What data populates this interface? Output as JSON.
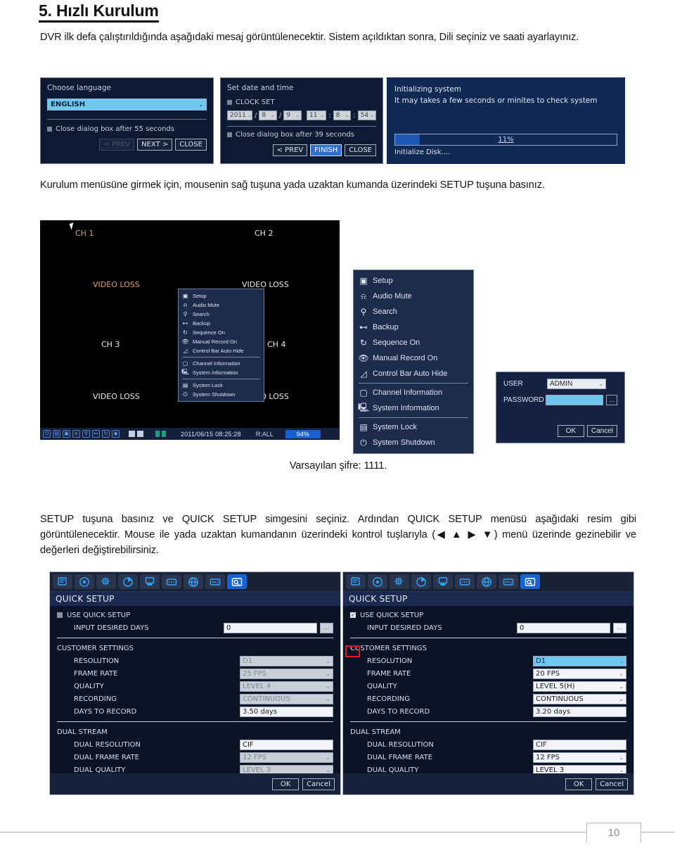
{
  "heading": "5. Hızlı Kurulum",
  "paragraphs": {
    "intro": "DVR ilk defa çalıştırıldığında aşağıdaki mesaj görüntülenecektir. Sistem açıldıktan sonra, Dili seçiniz ve saati ayarlayınız.",
    "setup": "Kurulum menüsüne girmek için, mousenin sağ tuşuna yada uzaktan kumanda üzerindeki SETUP tuşuna basınız.",
    "password": "Varsayılan şifre: 1111.",
    "quick": "SETUP tuşuna basınız ve QUICK SETUP simgesini seçiniz. Ardından QUICK SETUP menüsü aşağıdaki resim gibi görüntülenecektir. Mouse ile yada uzaktan kumandanın üzerindeki kontrol tuşlarıyla (◀ ▲ ▶ ▼) menü üzerinde gezinebilir ve değerleri değiştirebilirsiniz."
  },
  "dialog_language": {
    "title": "Choose language",
    "value": "ENGLISH",
    "arrow": "⌄",
    "close_text": "Close dialog box after 55 seconds",
    "btn_prev": "< PREV",
    "btn_next": "NEXT >",
    "btn_close": "CLOSE"
  },
  "dialog_datetime": {
    "title": "Set date and time",
    "clock_set": "CLOCK SET",
    "year": "2011",
    "month": "8",
    "day": "9",
    "hour": "11",
    "minute": "8",
    "second": "54",
    "sep_date": "/",
    "sep_time": ":",
    "spin": "⌄",
    "close_text": "Close dialog box after 39 seconds",
    "btn_prev": "< PREV",
    "btn_finish": "FINISH",
    "btn_close": "CLOSE"
  },
  "dialog_init": {
    "line1": "Initializing system",
    "line2": "It may takes a few seconds or minites to check system",
    "progress_label": "11%",
    "progress_value": 11,
    "footer": "Initialize Disk...."
  },
  "dvr_live": {
    "channels": [
      {
        "name": "CH 1",
        "status": "VIDEO LOSS"
      },
      {
        "name": "CH 2",
        "status": "VIDEO LOSS"
      },
      {
        "name": "CH 3",
        "status": "VIDEO LOSS"
      },
      {
        "name": "CH 4",
        "status": "VIDEO LOSS"
      }
    ],
    "status_bar": {
      "datetime": "2011/06/15 08:25:28",
      "record_mode": "R:ALL",
      "disk_percent": "94%"
    }
  },
  "context_menu": {
    "items": [
      {
        "label": "Setup",
        "icon": "setup-icon",
        "glyph": "▣"
      },
      {
        "label": "Audio Mute",
        "icon": "microphone-icon",
        "glyph": "⍾"
      },
      {
        "label": "Search",
        "icon": "search-icon",
        "glyph": "⚲"
      },
      {
        "label": "Backup",
        "icon": "backup-icon",
        "glyph": "⊷"
      },
      {
        "label": "Sequence On",
        "icon": "sequence-icon",
        "glyph": "↻"
      },
      {
        "label": "Manual Record On",
        "icon": "record-icon",
        "glyph": "👁"
      },
      {
        "label": "Control Bar Auto Hide",
        "icon": "autohide-icon",
        "glyph": "◿"
      },
      {
        "label": "Channel Information",
        "icon": "channel-info-icon",
        "glyph": "▢"
      },
      {
        "label": "System Information",
        "icon": "system-info-icon",
        "glyph": "🖳"
      },
      {
        "label": "System Lock",
        "icon": "lock-icon",
        "glyph": "▤"
      },
      {
        "label": "System Shutdown",
        "icon": "power-icon",
        "glyph": "⏻"
      }
    ],
    "dividers_after": [
      6,
      8
    ]
  },
  "login_dialog": {
    "user_label": "USER",
    "user_value": "ADMIN",
    "password_label": "PASSWORD",
    "password_value": "",
    "dots_label": "...",
    "arrow": "⌄",
    "btn_ok": "OK",
    "btn_cancel": "Cancel"
  },
  "quick_setup": {
    "toolbar_icons": [
      "record-setup-icon",
      "disk-icon",
      "gear-icon",
      "pie-chart-icon",
      "display-icon",
      "keypad-icon",
      "network-icon",
      "card-icon",
      "quick-setup-icon"
    ],
    "active_icon_index": 8,
    "title": "QUICK SETUP",
    "use_label": "USE QUICK SETUP",
    "input_days_label": "INPUT DESIRED DAYS",
    "customer_settings_label": "CUSTOMER SETTINGS",
    "dual_stream_label": "DUAL STREAM",
    "row_labels": {
      "resolution": "RESOLUTION",
      "frame_rate": "FRAME RATE",
      "quality": "QUALITY",
      "recording": "RECORDING",
      "days_to_record": "DAYS TO RECORD",
      "dual_resolution": "DUAL RESOLUTION",
      "dual_frame_rate": "DUAL FRAME RATE",
      "dual_quality": "DUAL QUALITY"
    },
    "btn_ok": "OK",
    "btn_cancel": "Cancel",
    "dots": "...",
    "arrow": "⌄",
    "check_mark": "✓",
    "left": {
      "use_quick_setup": false,
      "input_days": "0",
      "resolution": "D1",
      "frame_rate": "25 FPS",
      "quality": "LEVEL 4",
      "recording": "CONTINUOUS",
      "days_to_record": "3.50 days",
      "dual_resolution": "CIF",
      "dual_frame_rate": "12 FPS",
      "dual_quality": "LEVEL 3"
    },
    "right": {
      "use_quick_setup": true,
      "input_days": "0",
      "resolution": "D1",
      "frame_rate": "20 FPS",
      "quality": "LEVEL 5(H)",
      "recording": "CONTINUOUS",
      "days_to_record": "3.20 days",
      "dual_resolution": "CIF",
      "dual_frame_rate": "12 FPS",
      "dual_quality": "LEVEL 3"
    }
  },
  "footer": {
    "page_number": "10"
  }
}
